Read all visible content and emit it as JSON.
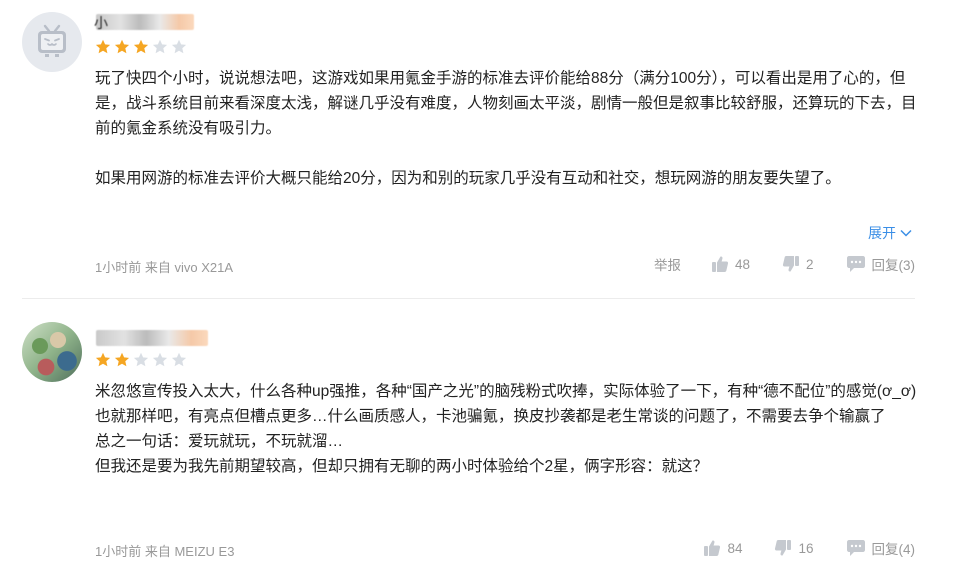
{
  "colors": {
    "star_on": "#f5a623",
    "star_off": "#d9dee4",
    "link": "#3a8ee6",
    "meta": "#999999",
    "text": "#222222"
  },
  "reviews": [
    {
      "avatar": "bilibili-tv-avatar",
      "username_visible": "小",
      "rating": 3,
      "rating_max": 5,
      "paragraphs": [
        "玩了快四个小时，说说想法吧，这游戏如果用氪金手游的标准去评价能给88分（满分100分），可以看出是用了心的，但是，战斗系统目前来看深度太浅，解谜几乎没有难度，人物刻画太平淡，剧情一般但是叙事比较舒服，还算玩的下去，目前的氪金系统没有吸引力。",
        "如果用网游的标准去评价大概只能给20分，因为和别的玩家几乎没有互动和社交，想玩网游的朋友要失望了。"
      ],
      "expand_label": "展开",
      "time": "1小时前",
      "source": "来自 vivo X21A",
      "report_label": "举报",
      "likes": "48",
      "dislikes": "2",
      "reply_label": "回复(3)"
    },
    {
      "avatar": "anime-group-avatar",
      "username_visible": "",
      "rating": 2,
      "rating_max": 5,
      "paragraphs": [
        "米忽悠宣传投入太大，什么各种up强推，各种“国产之光”的脑残粉式吹捧，实际体验了一下，有种“德不配位”的感觉(ơ_ơ)",
        "也就那样吧，有亮点但槽点更多…什么画质感人，卡池骗氪，换皮抄袭都是老生常谈的问题了，不需要去争个输赢了",
        "总之一句话：爱玩就玩，不玩就溜…",
        "但我还是要为我先前期望较高，但却只拥有无聊的两小时体验给个2星，俩字形容：就这？"
      ],
      "time": "1小时前",
      "source": "来自 MEIZU E3",
      "likes": "84",
      "dislikes": "16",
      "reply_label": "回复(4)"
    }
  ]
}
